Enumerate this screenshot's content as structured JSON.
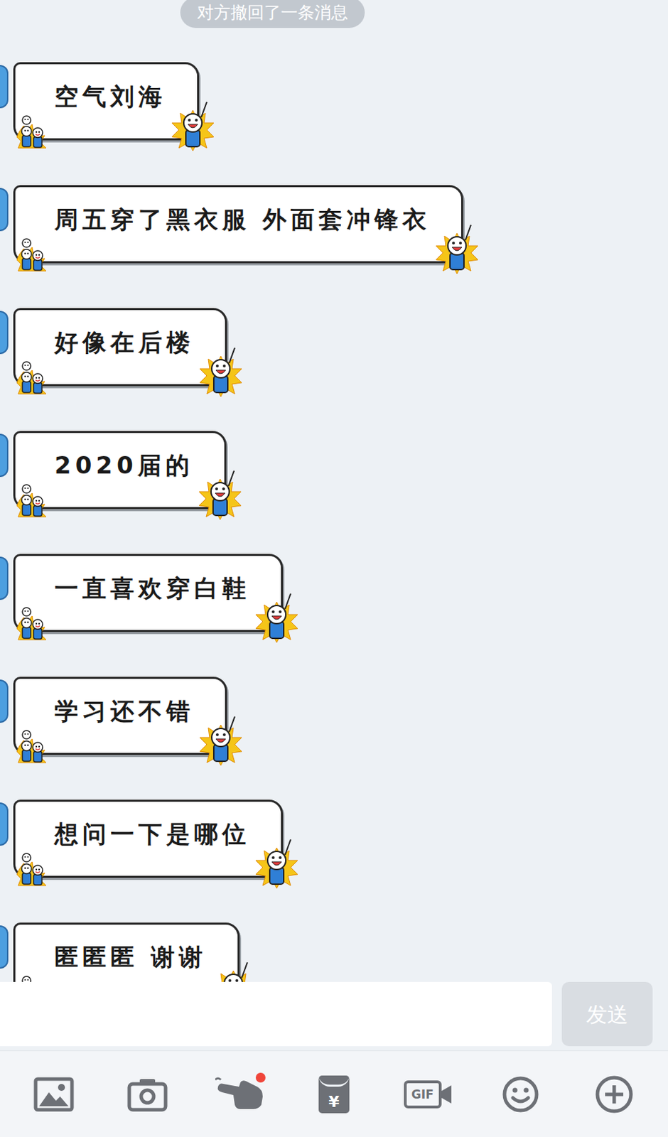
{
  "notice": "对方撤回了一条消息",
  "messages": [
    {
      "text": "空气刘海"
    },
    {
      "text": "周五穿了黑衣服 外面套冲锋衣"
    },
    {
      "text": "好像在后楼"
    },
    {
      "text": "2020届的"
    },
    {
      "text": "一直喜欢穿白鞋"
    },
    {
      "text": "学习还不错"
    },
    {
      "text": "想问一下是哪位"
    },
    {
      "text": "匿匿匿 谢谢"
    }
  ],
  "send_button": "发送",
  "toolbar": [
    {
      "badge": false
    },
    {
      "badge": false
    },
    {
      "badge": true
    },
    {
      "glyph": "¥",
      "badge": false
    },
    {
      "glyph": "GIF",
      "badge": false
    },
    {
      "badge": false
    },
    {
      "badge": false
    }
  ]
}
